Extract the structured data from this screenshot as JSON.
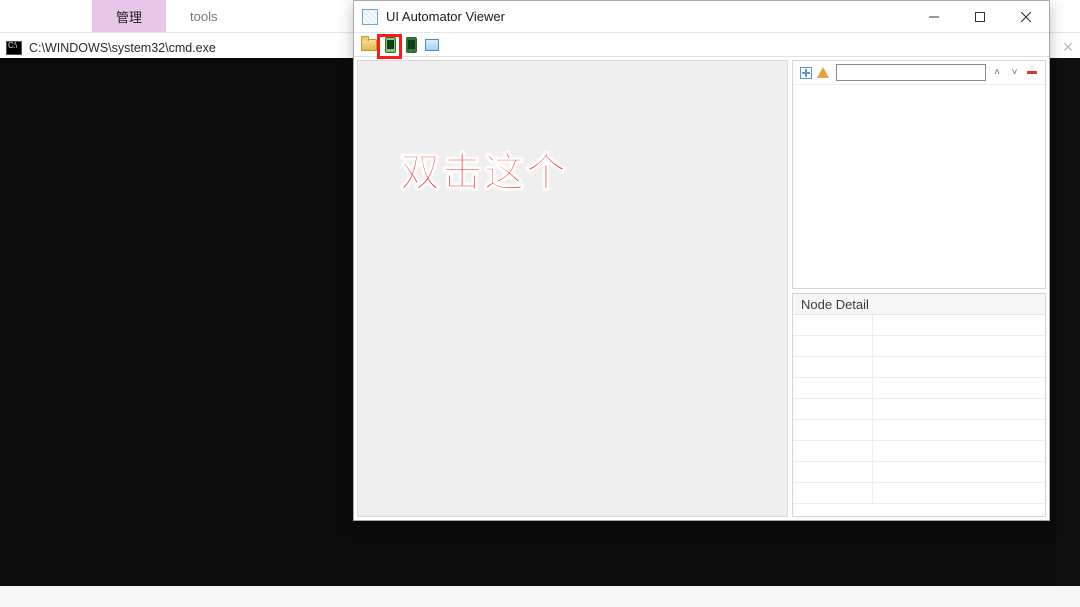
{
  "explorer_tabs": {
    "active": "管理",
    "plain": "tools"
  },
  "cmd": {
    "title": "C:\\WINDOWS\\system32\\cmd.exe"
  },
  "uav": {
    "title": "UI Automator Viewer",
    "detail_header": "Node Detail",
    "tree_search_value": ""
  },
  "annotation_text": "双击这个",
  "colors": {
    "highlight": "#ff1a1a",
    "ribbon_active": "#e6c7e8"
  }
}
